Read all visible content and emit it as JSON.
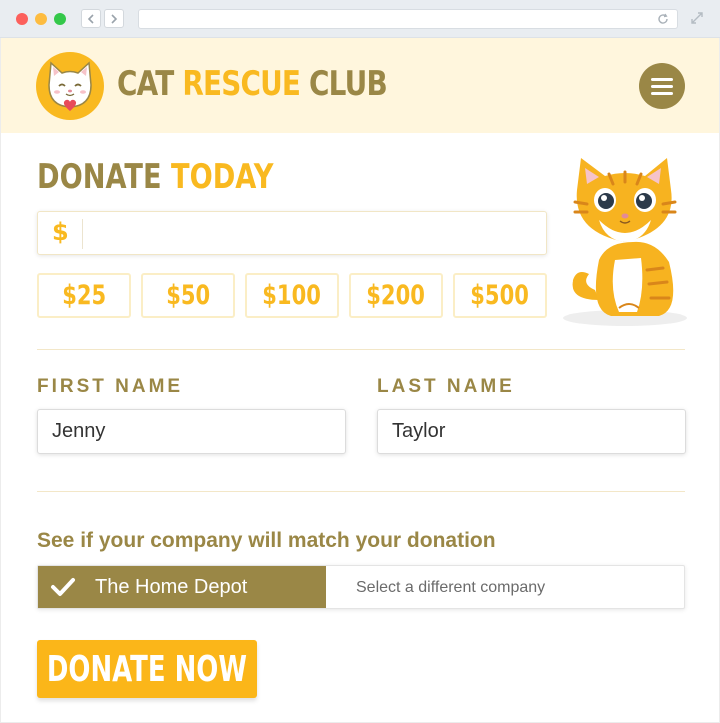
{
  "header": {
    "brand_part1": "CAT ",
    "brand_part2": "RESCUE ",
    "brand_part3": "CLUB"
  },
  "donate": {
    "title_part1": "DONATE ",
    "title_part2": "TODAY",
    "currency_symbol": "$",
    "amount_value": "",
    "presets": [
      "$25",
      "$50",
      "$100",
      "$200",
      "$500"
    ]
  },
  "form": {
    "first_name_label": "FIRST NAME",
    "first_name_value": "Jenny",
    "last_name_label": "LAST NAME",
    "last_name_value": "Taylor"
  },
  "matching": {
    "prompt": "See if your company will match your donation",
    "selected_company": "The Home Depot",
    "other_option": "Select a different company"
  },
  "cta": {
    "label": "DONATE NOW"
  },
  "colors": {
    "brand_olive": "#9a8746",
    "brand_gold": "#f9b920",
    "header_bg": "#fff6dd"
  }
}
